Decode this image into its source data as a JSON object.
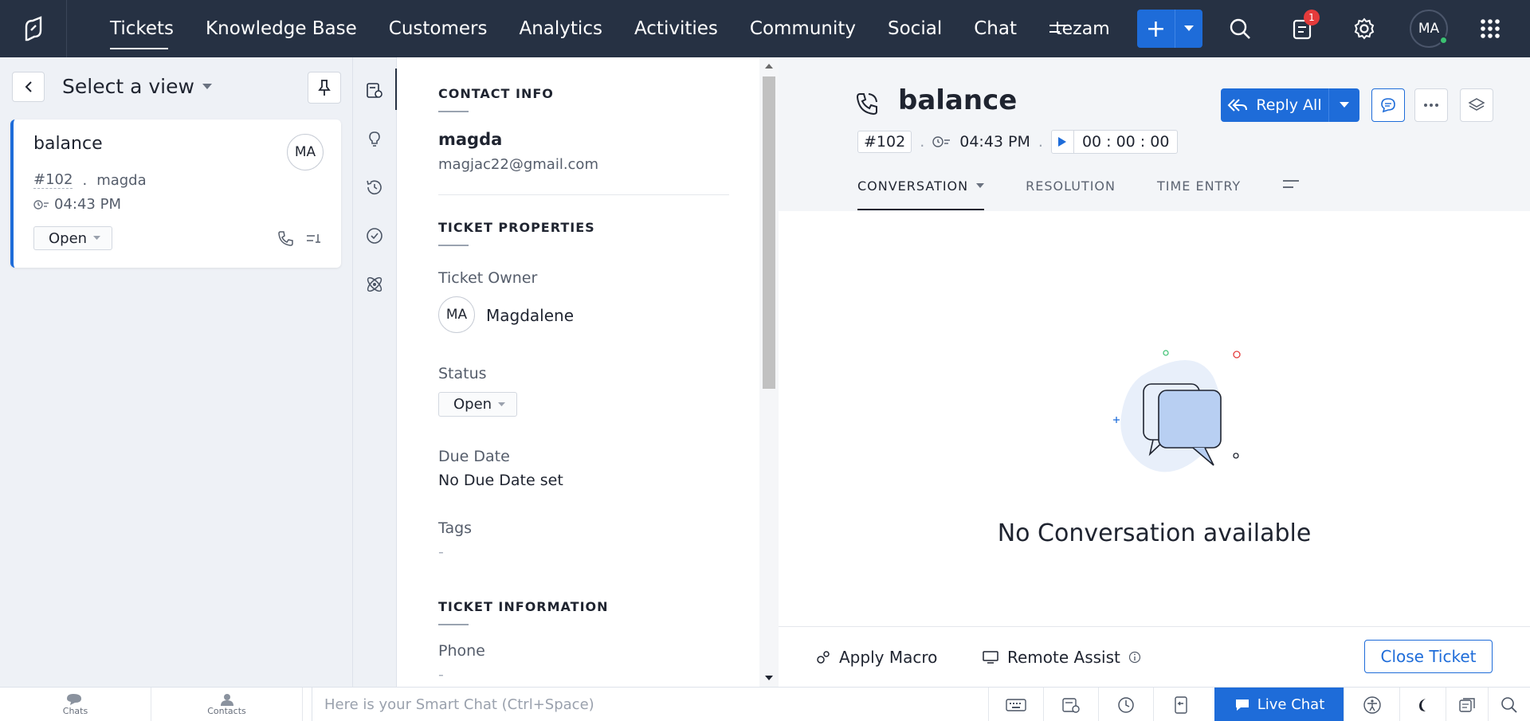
{
  "nav": {
    "items": [
      "Tickets",
      "Knowledge Base",
      "Customers",
      "Analytics",
      "Activities",
      "Community",
      "Social",
      "Chat"
    ],
    "workspace": "tezam",
    "notification_count": "1",
    "user_initials": "MA"
  },
  "list": {
    "view_label": "Select a view",
    "ticket": {
      "subject": "balance",
      "number": "#102",
      "contact": "magda",
      "time": "04:43 PM",
      "status": "Open",
      "avatar": "MA"
    }
  },
  "props": {
    "contact_header": "CONTACT INFO",
    "contact_name": "magda",
    "contact_email": "magjac22@gmail.com",
    "ticket_props_header": "TICKET PROPERTIES",
    "owner_label": "Ticket Owner",
    "owner_initials": "MA",
    "owner_name": "Magdalene",
    "status_label": "Status",
    "status_value": "Open",
    "due_label": "Due Date",
    "due_value": "No Due Date set",
    "tags_label": "Tags",
    "tags_value": "-",
    "ticket_info_header": "TICKET INFORMATION",
    "phone_label": "Phone",
    "phone_value": "-"
  },
  "main": {
    "subject": "balance",
    "number": "#102",
    "time": "04:43 PM",
    "timer": "00 : 00 : 00",
    "reply_all": "Reply All",
    "tabs": [
      "CONVERSATION",
      "RESOLUTION",
      "TIME ENTRY"
    ],
    "empty_message": "No Conversation available",
    "apply_macro": "Apply Macro",
    "remote_assist": "Remote Assist",
    "close_ticket": "Close Ticket"
  },
  "footer": {
    "chats": "Chats",
    "contacts": "Contacts",
    "smartchat_placeholder": "Here is your Smart Chat (Ctrl+Space)",
    "live_chat": "Live Chat"
  },
  "colors": {
    "nav_bg": "#263143",
    "accent": "#1e6cd9",
    "badge": "#e43b3b",
    "online": "#3bc171"
  }
}
